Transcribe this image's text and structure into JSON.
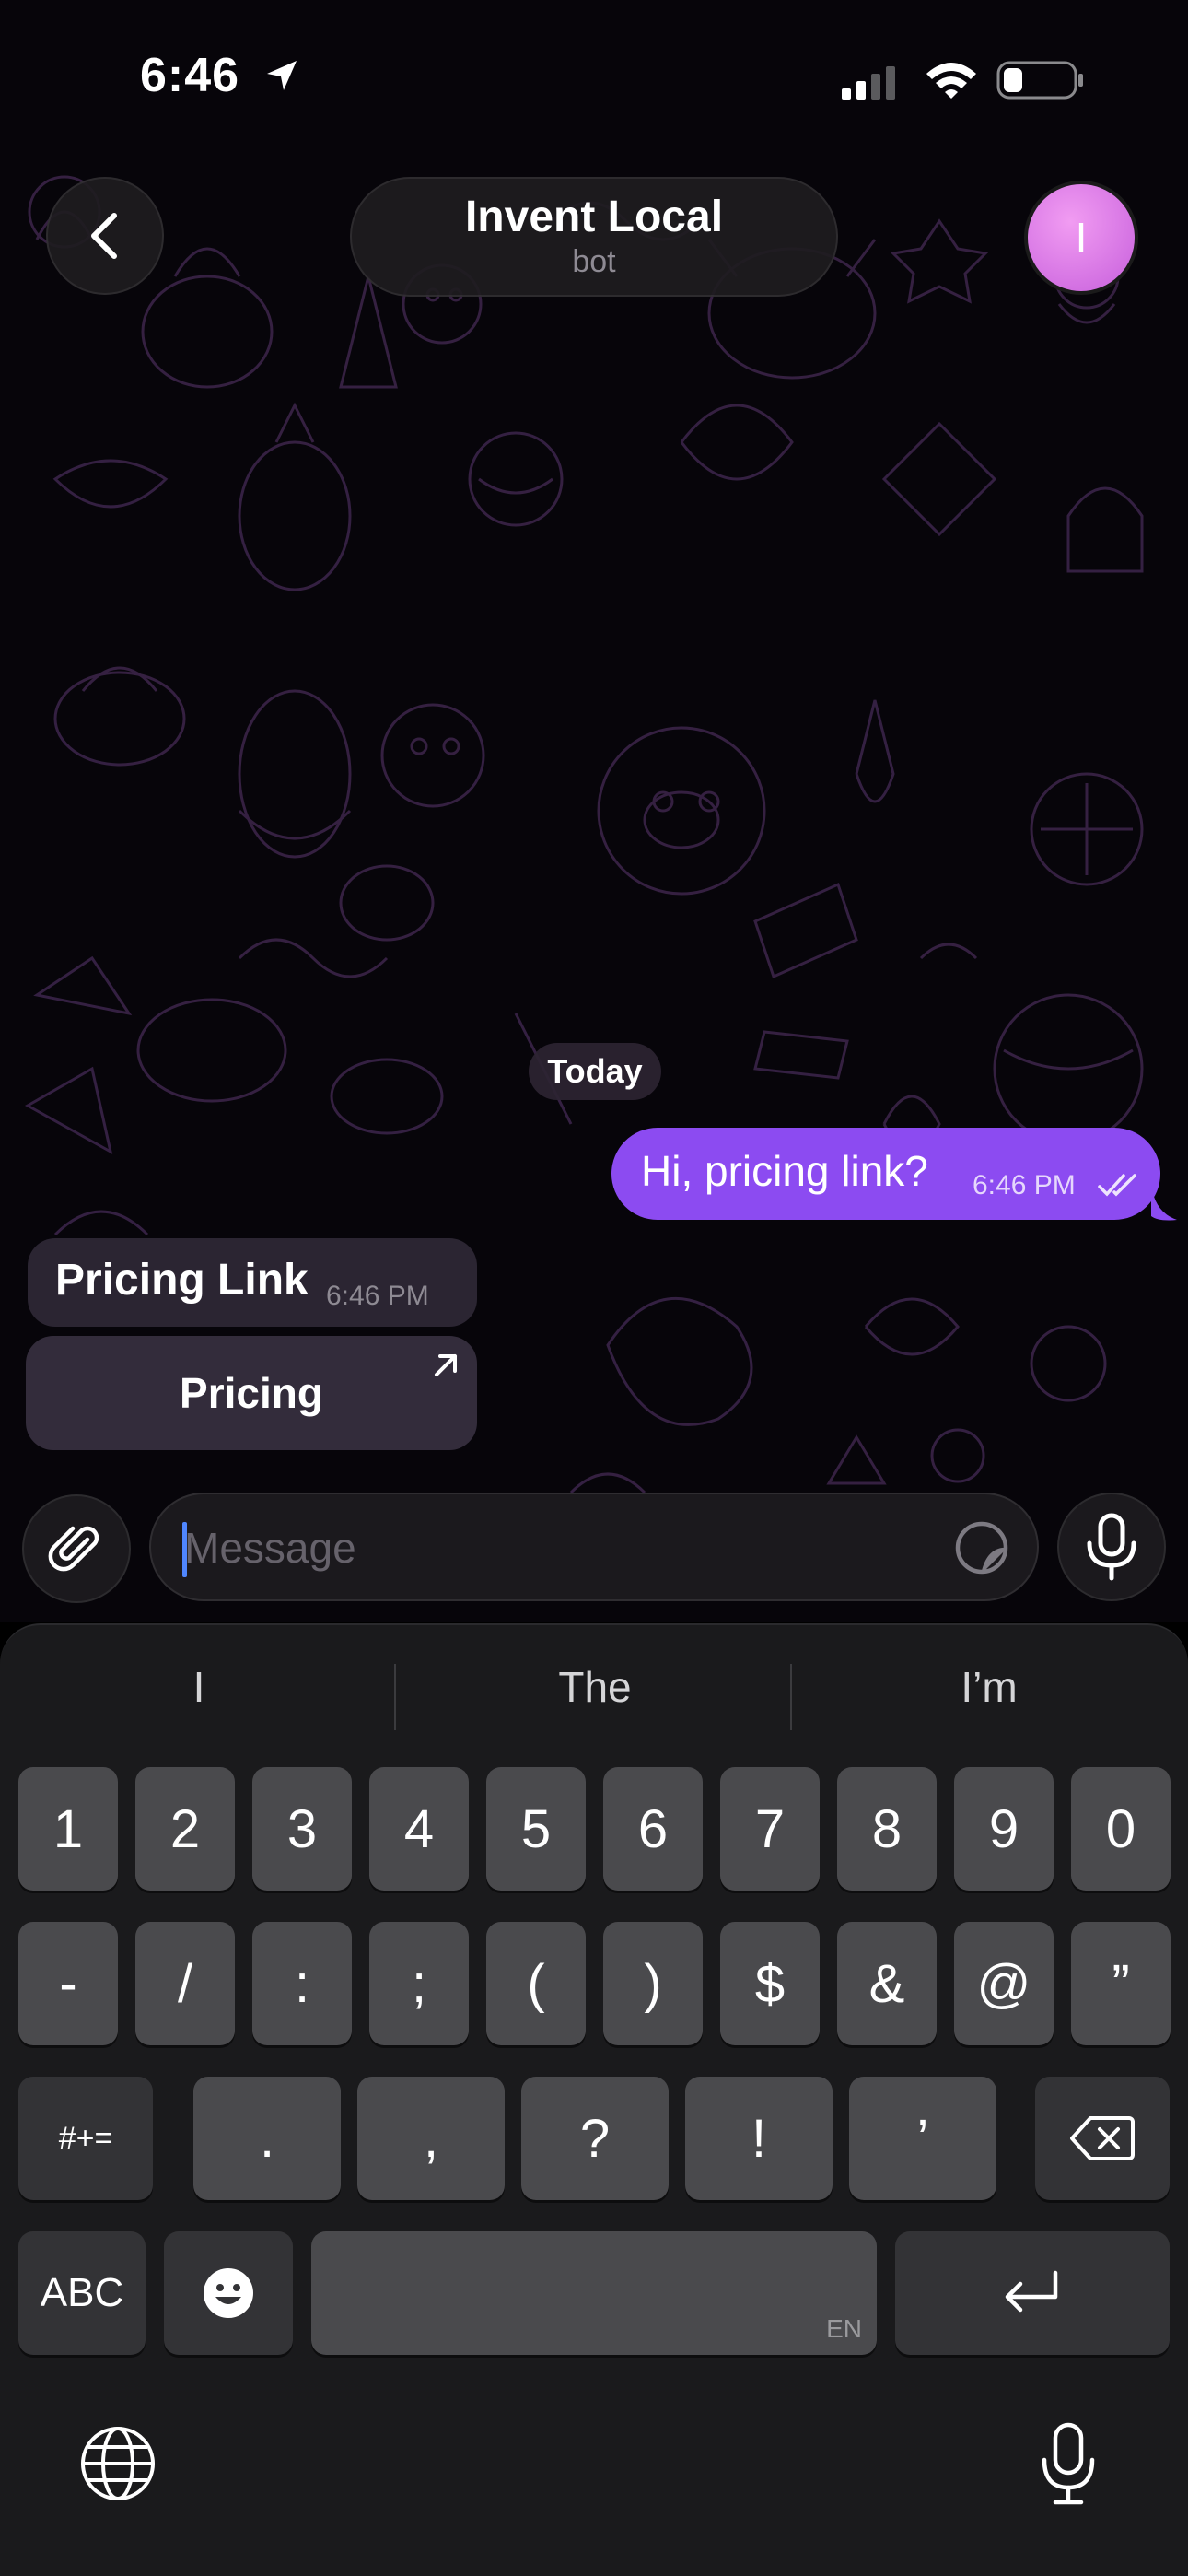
{
  "status_bar": {
    "time": "6:46"
  },
  "header": {
    "title": "Invent Local",
    "subtitle": "bot",
    "avatar_letter": "I"
  },
  "chat": {
    "date_chip": "Today",
    "outgoing": {
      "text": "Hi, pricing link?",
      "time": "6:46 PM",
      "status": "read"
    },
    "incoming": {
      "text": "Pricing Link",
      "time": "6:46 PM"
    },
    "inline_button": {
      "label": "Pricing"
    }
  },
  "composer": {
    "placeholder": "Message"
  },
  "keyboard": {
    "suggestions": [
      "I",
      "The",
      "I’m"
    ],
    "row1": [
      "1",
      "2",
      "3",
      "4",
      "5",
      "6",
      "7",
      "8",
      "9",
      "0"
    ],
    "row2": [
      "-",
      "/",
      ":",
      ";",
      "(",
      ")",
      "$",
      "&",
      "@",
      "”"
    ],
    "row3_left": "#+=",
    "row3": [
      ".",
      ",",
      "?",
      "!",
      "’"
    ],
    "abc": "ABC",
    "space_lang": "EN"
  },
  "colors": {
    "accent": "#8c4bf1",
    "avatar": "#d86ee6",
    "background": "#000000"
  }
}
